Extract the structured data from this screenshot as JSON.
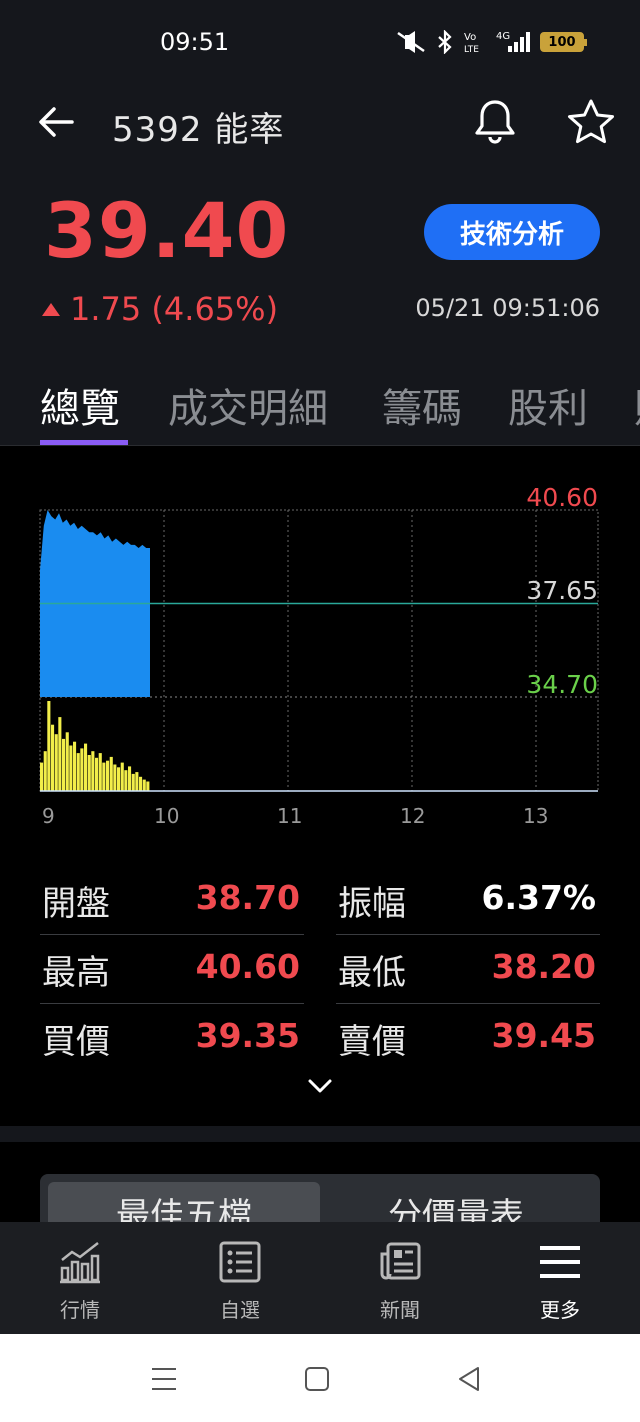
{
  "status_bar": {
    "time": "09:51",
    "battery": "100",
    "icons": [
      "mute-icon",
      "bluetooth-icon",
      "volte-icon",
      "signal-4g-icon",
      "battery-icon"
    ]
  },
  "header": {
    "title": "5392 能率",
    "icons": [
      "back-icon",
      "bell-icon",
      "star-icon"
    ]
  },
  "quote": {
    "price": "39.40",
    "change": "1.75 (4.65%)",
    "timestamp": "05/21 09:51:06",
    "tech_button": "技術分析",
    "colors": {
      "up": "#f04a4f",
      "down": "#6ad04a",
      "accent": "#1f6ff5"
    }
  },
  "tabs": [
    "總覽",
    "成交明細",
    "籌碼",
    "股利"
  ],
  "active_tab": "總覽",
  "chart_labels": {
    "high": "40.60",
    "ref": "37.65",
    "low": "34.70",
    "x_ticks": [
      "9",
      "10",
      "11",
      "12",
      "13"
    ]
  },
  "chart_data": {
    "type": "area",
    "x_range": [
      "09:00",
      "13:30"
    ],
    "ylim": [
      34.7,
      40.6
    ],
    "reference": 37.65,
    "price_series": [
      38.7,
      40.1,
      40.6,
      40.4,
      40.3,
      40.5,
      40.2,
      40.3,
      40.1,
      40.2,
      40.0,
      40.1,
      40.0,
      39.9,
      39.9,
      39.8,
      39.9,
      39.7,
      39.8,
      39.6,
      39.7,
      39.6,
      39.5,
      39.6,
      39.5,
      39.5,
      39.4,
      39.5,
      39.4,
      39.4
    ],
    "volume_series": [
      30,
      42,
      95,
      70,
      60,
      78,
      55,
      62,
      48,
      52,
      40,
      45,
      50,
      38,
      42,
      35,
      40,
      30,
      32,
      36,
      28,
      25,
      30,
      22,
      26,
      18,
      20,
      15,
      12,
      10
    ],
    "grid": true
  },
  "stats": [
    {
      "label": "開盤",
      "value": "38.70"
    },
    {
      "label": "振幅",
      "value": "6.37%"
    },
    {
      "label": "最高",
      "value": "40.60"
    },
    {
      "label": "最低",
      "value": "38.20"
    },
    {
      "label": "買價",
      "value": "39.35"
    },
    {
      "label": "賣價",
      "value": "39.45"
    }
  ],
  "panel_tabs": [
    "最佳五檔",
    "分價量表"
  ],
  "bottom_nav": [
    {
      "label": "行情",
      "icon": "chart-bars-icon"
    },
    {
      "label": "自選",
      "icon": "list-icon"
    },
    {
      "label": "新聞",
      "icon": "news-icon"
    },
    {
      "label": "更多",
      "icon": "menu-icon"
    }
  ],
  "system_nav": [
    "recents-icon",
    "home-icon",
    "back-triangle-icon"
  ]
}
